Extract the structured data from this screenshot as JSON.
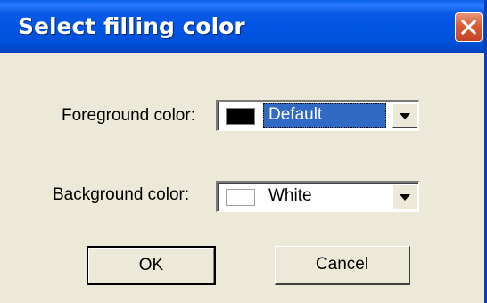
{
  "window": {
    "title": "Select filling color"
  },
  "foreground": {
    "label": "Foreground color:",
    "swatch_color": "#000000",
    "value": "Default"
  },
  "background": {
    "label": "Background color:",
    "swatch_color": "#ffffff",
    "value": "White"
  },
  "buttons": {
    "ok_label": "OK",
    "cancel_label": "Cancel"
  },
  "icons": {
    "close": "close-icon",
    "dropdown": "chevron-down-icon"
  },
  "colors": {
    "titlebar": "#0054e3",
    "dialog_background": "#ece9d8",
    "selection_highlight": "#316ac5",
    "close_button": "#d85b35"
  }
}
